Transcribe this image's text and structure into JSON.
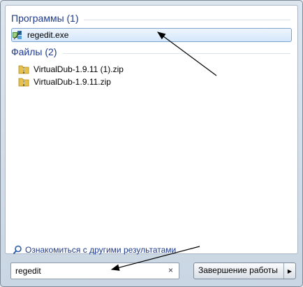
{
  "groups": [
    {
      "header": "Программы (1)",
      "items": [
        {
          "label": "regedit.exe",
          "icon": "regedit-icon"
        }
      ]
    },
    {
      "header": "Файлы (2)",
      "items": [
        {
          "label": "VirtualDub-1.9.11 (1).zip",
          "icon": "zip-folder-icon"
        },
        {
          "label": "VirtualDub-1.9.11.zip",
          "icon": "zip-folder-icon"
        }
      ]
    }
  ],
  "see_more": {
    "label": "Ознакомиться с другими результатами",
    "icon": "search-icon"
  },
  "search": {
    "value": "regedit",
    "clear_symbol": "×"
  },
  "shutdown": {
    "label": "Завершение работы",
    "arrow": "▶"
  },
  "colors": {
    "header_text": "#1e3a8a",
    "selection_border": "#7da2ce",
    "annotation_arrow": "#000000"
  }
}
